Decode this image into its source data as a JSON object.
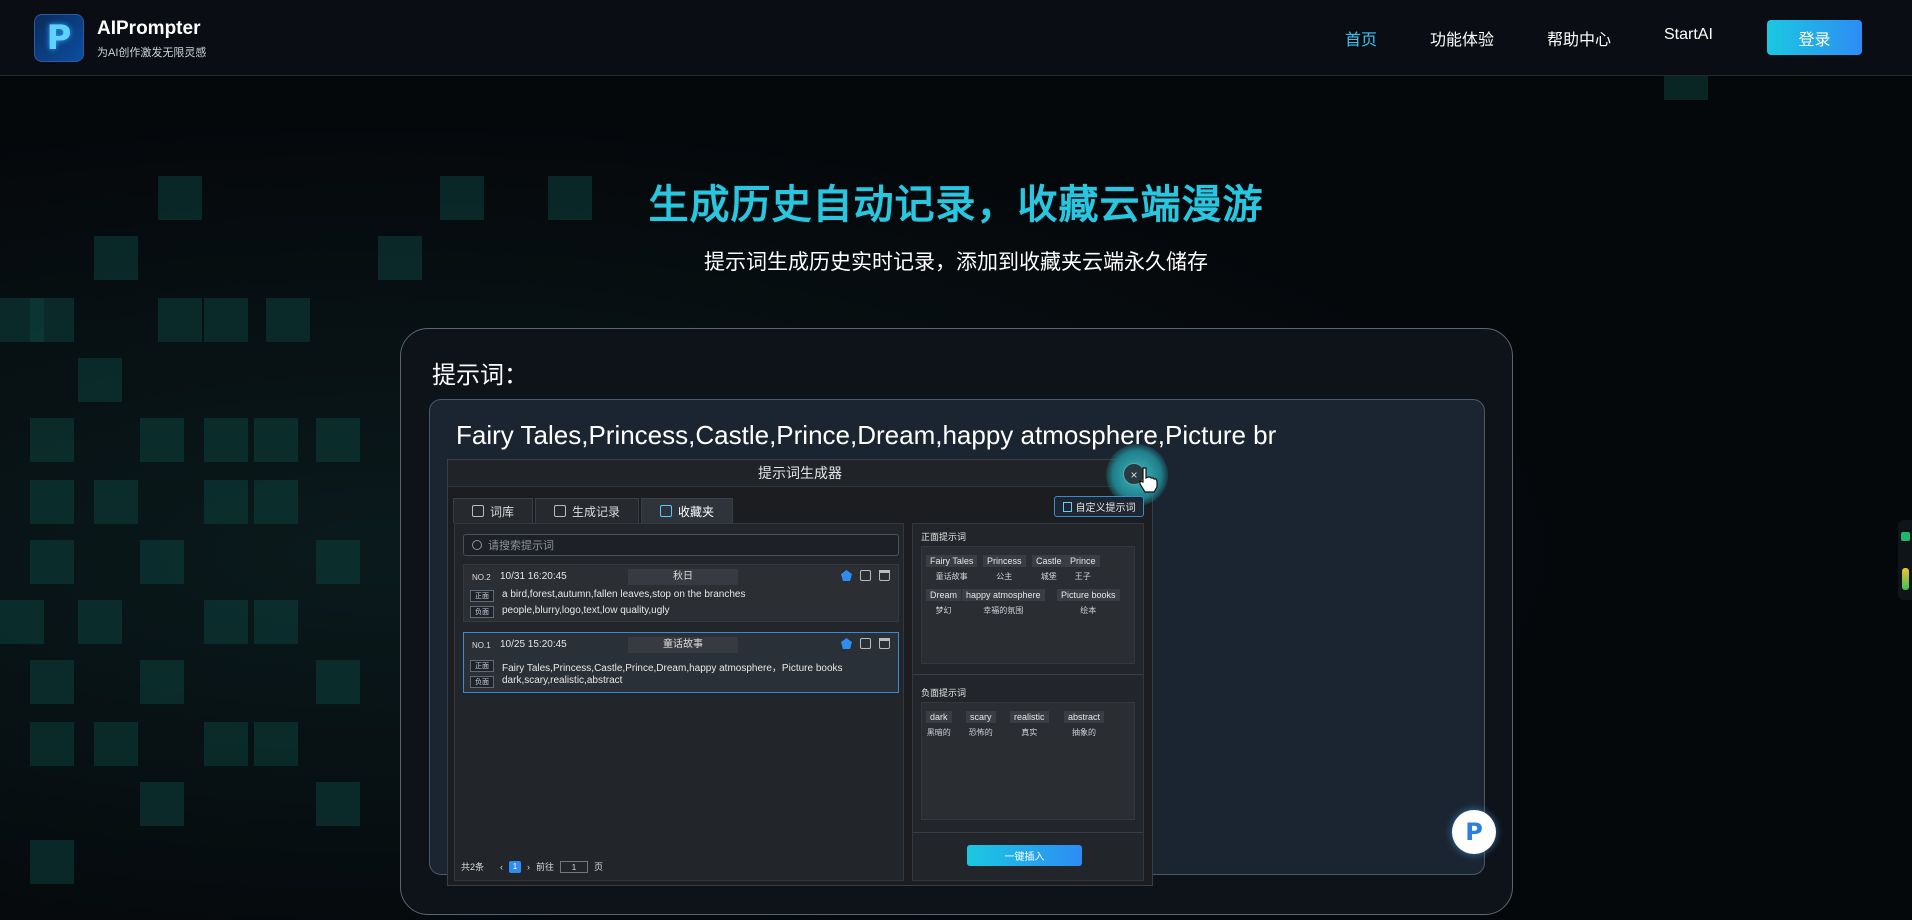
{
  "header": {
    "brand_name": "AIPrompter",
    "brand_tagline": "为AI创作激发无限灵感",
    "nav": [
      "首页",
      "功能体验",
      "帮助中心",
      "StartAI"
    ],
    "active_nav": "首页",
    "login_label": "登录"
  },
  "hero": {
    "title": "生成历史自动记录，收藏云端漫游",
    "subtitle": "提示词生成历史实时记录，添加到收藏夹云端永久储存"
  },
  "card": {
    "label": "提示词：",
    "prompt_text": "Fairy Tales,Princess,Castle,Prince,Dream,happy atmosphere,Picture br"
  },
  "generator": {
    "title": "提示词生成器",
    "close_label": "×",
    "tabs": [
      "词库",
      "生成记录",
      "收藏夹"
    ],
    "active_tab": "收藏夹",
    "custom_label": "自定义提示词",
    "search_placeholder": "请搜索提示词",
    "records": [
      {
        "no": "NO.2",
        "time": "10/31 16:20:45",
        "name": "秋日",
        "pos_tag": "正面",
        "neg_tag": "负面",
        "positive": "a bird,forest,autumn,fallen leaves,stop on the branches",
        "negative": "people,blurry,logo,text,low quality,ugly"
      },
      {
        "no": "NO.1",
        "time": "10/25 15:20:45",
        "name": "童话故事",
        "pos_tag": "正面",
        "neg_tag": "负面",
        "positive": "Fairy Tales,Princess,Castle,Prince,Dream,happy atmosphere，Picture books",
        "negative": "dark,scary,realistic,abstract"
      }
    ],
    "pager": {
      "total": "共2条",
      "current": "1",
      "goto_label": "前往",
      "goto_value": "1",
      "page_suffix": "页"
    },
    "positive_title": "正面提示词",
    "positive_chips": [
      {
        "en": "Fairy Tales",
        "zh": "童话故事"
      },
      {
        "en": "Princess",
        "zh": "公主"
      },
      {
        "en": "Castle",
        "zh": "城堡"
      },
      {
        "en": "Prince",
        "zh": "王子"
      },
      {
        "en": "Dream",
        "zh": "梦幻"
      },
      {
        "en": "happy atmosphere",
        "zh": "幸福的氛围"
      },
      {
        "en": "Picture books",
        "zh": "绘本"
      }
    ],
    "negative_title": "负面提示词",
    "negative_chips": [
      {
        "en": "dark",
        "zh": "黑暗的"
      },
      {
        "en": "scary",
        "zh": "恐怖的"
      },
      {
        "en": "realistic",
        "zh": "真实"
      },
      {
        "en": "abstract",
        "zh": "抽象的"
      }
    ],
    "insert_label": "一键插入"
  },
  "colors": {
    "accent": "#29c6e0",
    "button_gradient_start": "#1bc8e0",
    "button_gradient_end": "#2d8cf5",
    "background": "#05080b"
  }
}
